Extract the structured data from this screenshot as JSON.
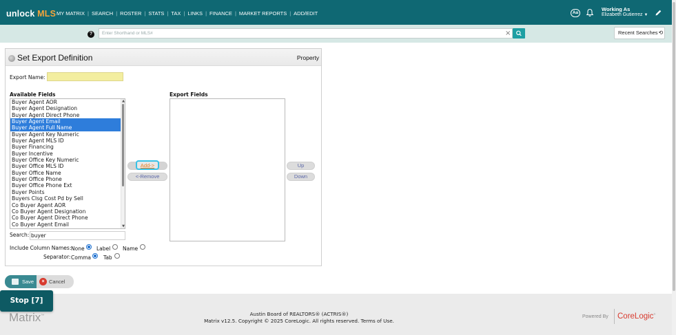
{
  "header": {
    "logo_part1": "unlock",
    "logo_part2": "MLS",
    "nav": [
      "MY MATRIX",
      "SEARCH",
      "ROSTER",
      "STATS",
      "TAX",
      "LINKS",
      "FINANCE",
      "MARKET REPORTS",
      "ADD/EDIT"
    ],
    "font_size_btn": "Aa",
    "working_as_label": "Working As",
    "working_as_name": "Elizabeth Gutierrez",
    "icons": {
      "notifications": "bell-icon",
      "edit": "pencil-icon",
      "help": "help-icon",
      "search": "search-icon",
      "history": "history-icon"
    }
  },
  "searchbar": {
    "placeholder": "Enter Shorthand or MLS#",
    "clear_glyph": "×",
    "recent_label": "Recent Searches"
  },
  "export": {
    "title": "Set Export Definition",
    "type": "Property",
    "export_name_label": "Export Name:",
    "export_name_value": "",
    "available_label": "Available Fields",
    "export_label": "Export Fields",
    "available_fields": [
      "Buyer Agent AOR",
      "Buyer Agent Designation",
      "Buyer Agent Direct Phone",
      "Buyer Agent Email",
      "Buyer Agent Full Name",
      "Buyer Agent Key Numeric",
      "Buyer Agent MLS ID",
      "Buyer Financing",
      "Buyer Incentive",
      "Buyer Office Key Numeric",
      "Buyer Office MLS ID",
      "Buyer Office Name",
      "Buyer Office Phone",
      "Buyer Office Phone Ext",
      "Buyer Points",
      "Buyers Clsg Cost Pd by Sell",
      "Co Buyer Agent AOR",
      "Co Buyer Agent Designation",
      "Co Buyer Agent Direct Phone",
      "Co Buyer Agent Email"
    ],
    "selected_fields": [
      "Buyer Agent Email",
      "Buyer Agent Full Name"
    ],
    "export_fields": [],
    "add_label": "Add->",
    "remove_label": "<-Remove",
    "up_label": "Up",
    "down_label": "Down",
    "search_label": "Search:",
    "search_value": "buyer",
    "include_label": "Include Column Names:",
    "include_options": [
      "None",
      "Label",
      "Name"
    ],
    "include_selected": "None",
    "separator_label": "Separator:",
    "separator_options": [
      "Comma",
      "Tab"
    ],
    "separator_selected": "Comma"
  },
  "actions": {
    "save_label": "Save",
    "cancel_label": "Cancel"
  },
  "footer": {
    "brand": "Matrix",
    "line1": "Austin Board of REALTORS® (ACTRIS®)",
    "line2": "Matrix v12.5. Copyright © 2025 CoreLogic. All rights reserved. Terms of Use.",
    "powered_by": "Powered By",
    "corelogic": "CoreLogic"
  },
  "overlay": {
    "stop_label": "Stop [7]"
  },
  "colors": {
    "header": "#0f6873",
    "strip": "#d6e8e5",
    "selection": "#2e7ddb",
    "save": "#3a8a92",
    "add_outline": "#37c1e6",
    "logo_accent": "#f5a43a",
    "corelogic": "#d83a2e"
  }
}
